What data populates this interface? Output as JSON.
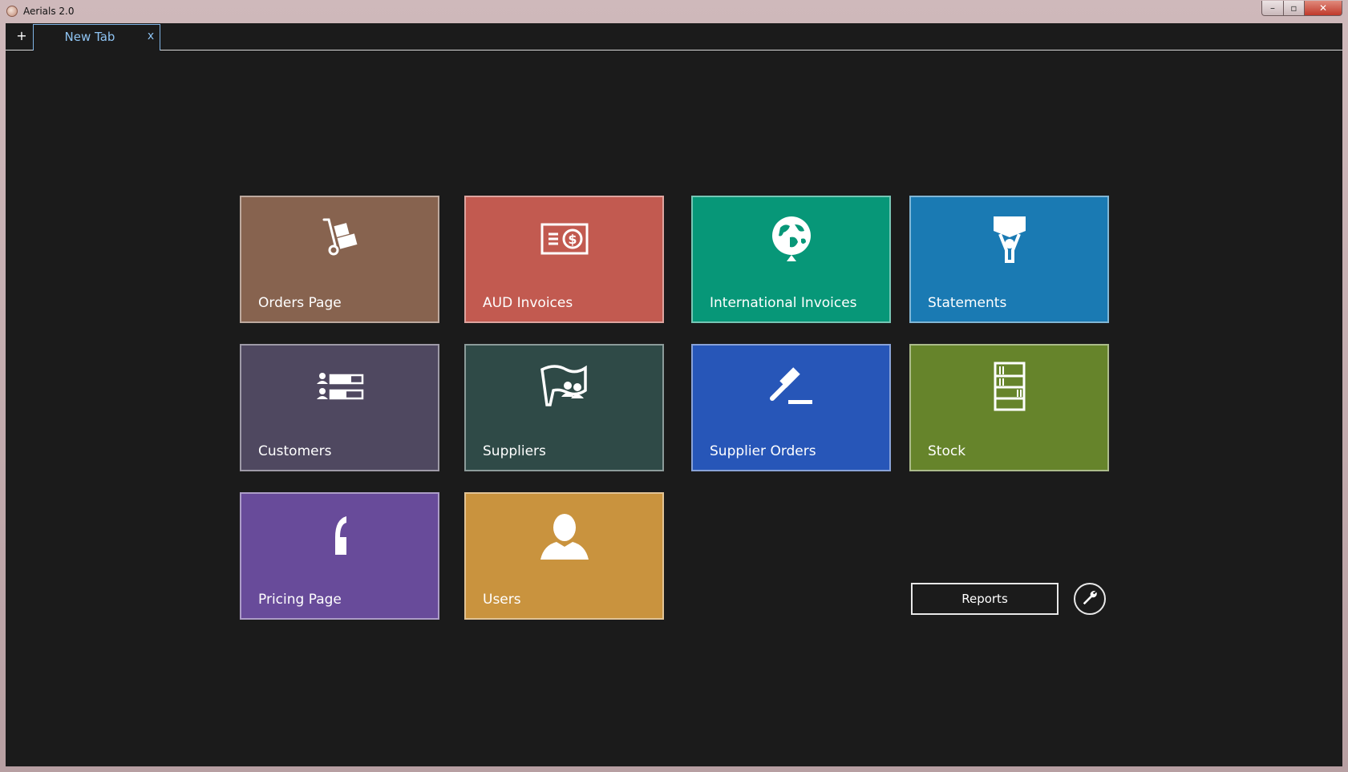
{
  "window": {
    "title": "Aerials 2.0",
    "controls": {
      "minimize": "–",
      "maximize": "▫",
      "close": "✕"
    }
  },
  "tabs": {
    "new_tab_button": "+",
    "items": [
      {
        "label": "New Tab",
        "close": "x"
      }
    ]
  },
  "tiles": [
    {
      "label": "Orders Page",
      "icon": "hand-truck-icon",
      "color": "#87634f"
    },
    {
      "label": "AUD Invoices",
      "icon": "dollar-bill-icon",
      "color": "#c25a50"
    },
    {
      "label": "International Invoices",
      "icon": "globe-pin-icon",
      "color": "#079778"
    },
    {
      "label": "Statements",
      "icon": "person-sign-icon",
      "color": "#1a7ab3"
    },
    {
      "label": "Customers",
      "icon": "customer-list-icon",
      "color": "#4f4860"
    },
    {
      "label": "Suppliers",
      "icon": "flag-people-icon",
      "color": "#2f4a47"
    },
    {
      "label": "Supplier Orders",
      "icon": "gavel-icon",
      "color": "#2756b8"
    },
    {
      "label": "Stock",
      "icon": "shelf-icon",
      "color": "#66842b"
    },
    {
      "label": "Pricing Page",
      "icon": "quote-icon",
      "color": "#684b9a"
    },
    {
      "label": "Users",
      "icon": "user-icon",
      "color": "#c9933e"
    }
  ],
  "footer": {
    "reports_label": "Reports",
    "settings_icon": "wrench-icon"
  }
}
